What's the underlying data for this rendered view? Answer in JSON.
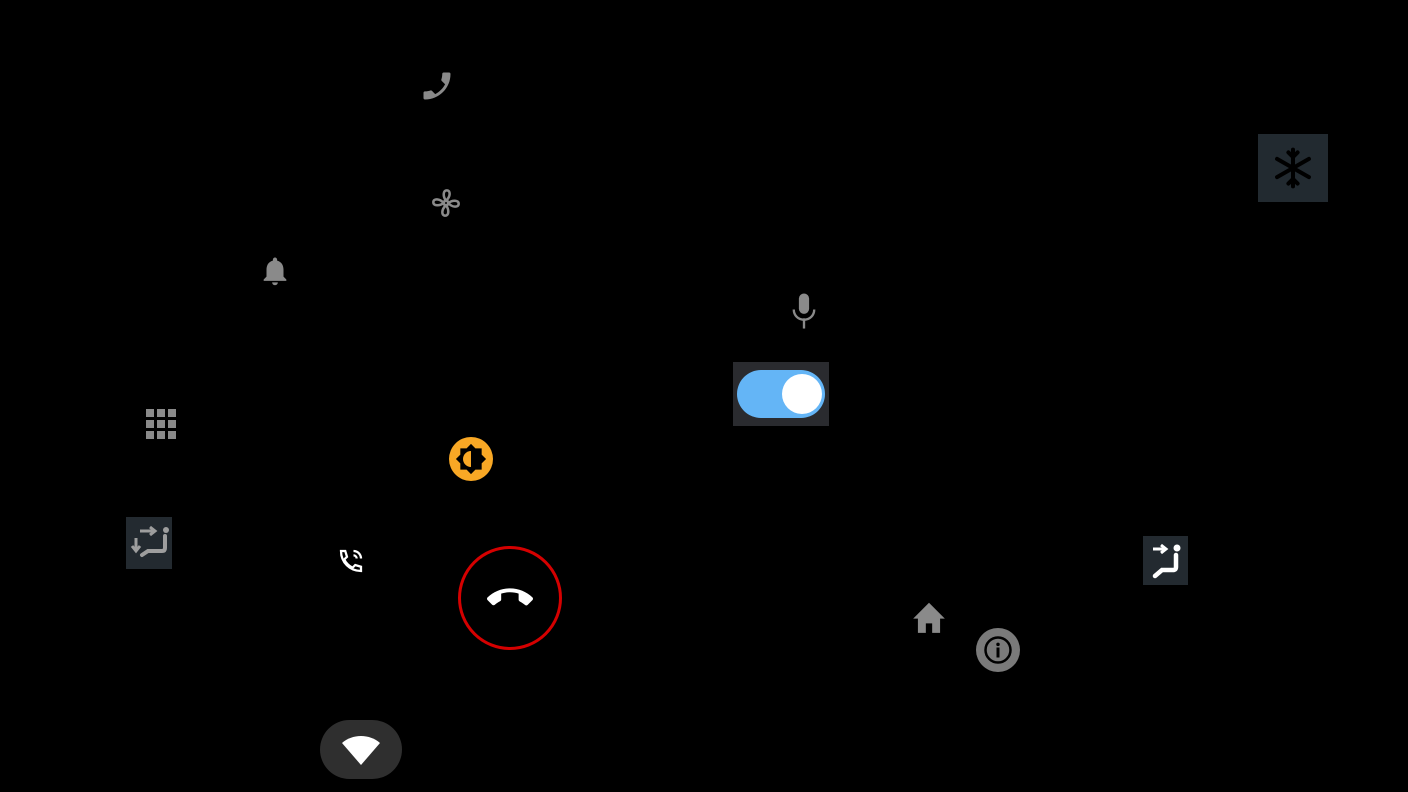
{
  "icons": [
    {
      "name": "phone-icon",
      "color": "#8a8a8a"
    },
    {
      "name": "fan-icon",
      "color": "#8a8a8a"
    },
    {
      "name": "bell-icon",
      "color": "#8a8a8a"
    },
    {
      "name": "snowflake-icon",
      "color": "#000000",
      "background": "#222a30"
    },
    {
      "name": "microphone-icon",
      "color": "#8a8a8a"
    },
    {
      "name": "dialpad-icon",
      "color": "#8a8a8a"
    },
    {
      "name": "brightness-icon",
      "color": "#f9a825"
    },
    {
      "name": "seat-recline-icon",
      "color": "#9e9e9e",
      "background": "#232a30"
    },
    {
      "name": "phone-callback-icon",
      "color": "#ffffff"
    },
    {
      "name": "end-call-icon",
      "color": "#ffffff",
      "ring": "#d50000"
    },
    {
      "name": "seat-icon",
      "color": "#ffffff",
      "background": "#232a30"
    },
    {
      "name": "home-icon",
      "color": "#8a8a8a"
    },
    {
      "name": "info-icon",
      "color": "#7a7a7a"
    },
    {
      "name": "wifi-icon",
      "color": "#ffffff",
      "background": "#2f2f2f"
    }
  ],
  "toggle": {
    "state": "on",
    "track_color": "#64b5f6",
    "thumb_color": "#ffffff",
    "background": "#2a2b2f"
  }
}
